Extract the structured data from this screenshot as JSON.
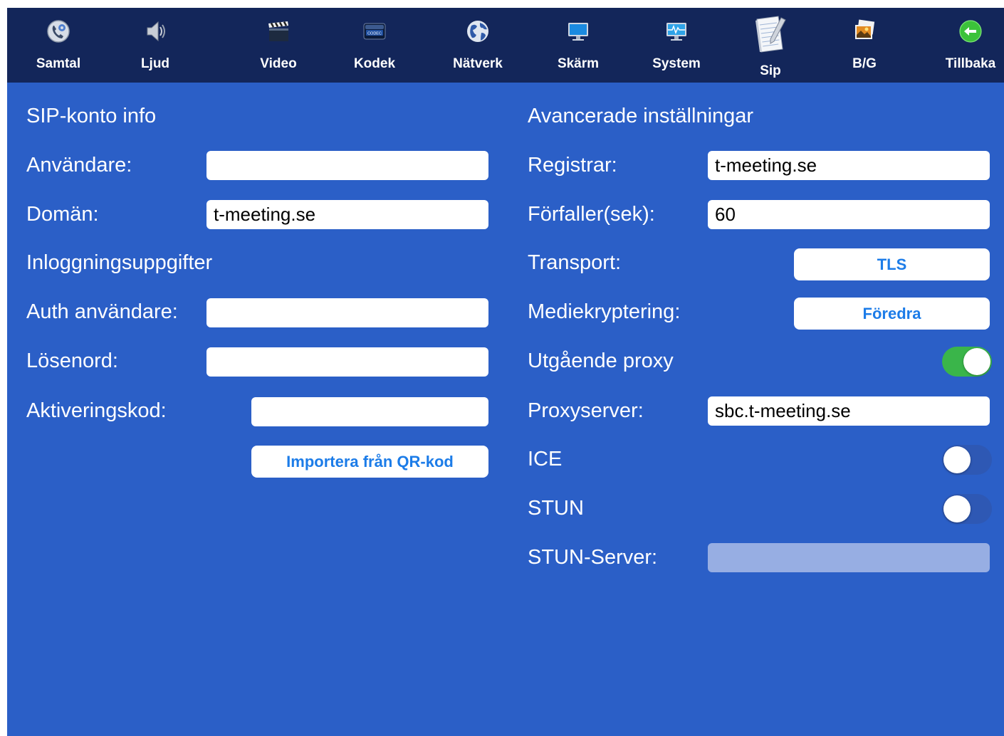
{
  "toolbar": {
    "items": [
      {
        "label": "Samtal",
        "icon": "phone-gear-icon"
      },
      {
        "label": "Ljud",
        "icon": "speaker-icon"
      },
      {
        "label": "Video",
        "icon": "clapperboard-icon"
      },
      {
        "label": "Kodek",
        "icon": "codec-chip-icon"
      },
      {
        "label": "Nätverk",
        "icon": "globe-icon"
      },
      {
        "label": "Skärm",
        "icon": "monitor-icon"
      },
      {
        "label": "System",
        "icon": "system-monitor-icon"
      },
      {
        "label": "Sip",
        "icon": "notepad-pen-icon",
        "active": true
      },
      {
        "label": "B/G",
        "icon": "pictures-icon"
      },
      {
        "label": "Tillbaka",
        "icon": "back-arrow-icon"
      }
    ],
    "codec_icon_text": "CODEC"
  },
  "left": {
    "title": "SIP-konto info",
    "user_label": "Användare:",
    "user_value": "",
    "domain_label": "Domän:",
    "domain_value": "t-meeting.se",
    "login_title": "Inloggningsuppgifter",
    "auth_user_label": "Auth användare:",
    "auth_user_value": "",
    "password_label": "Lösenord:",
    "password_value": "",
    "activation_label": "Aktiveringskod:",
    "activation_value": "",
    "qr_button": "Importera från QR-kod"
  },
  "right": {
    "title": "Avancerade inställningar",
    "registrar_label": "Registrar:",
    "registrar_value": "t-meeting.se",
    "expires_label": "Förfaller(sek):",
    "expires_value": "60",
    "transport_label": "Transport:",
    "transport_value": "TLS",
    "media_encryption_label": "Mediekryptering:",
    "media_encryption_value": "Föredra",
    "outbound_proxy_label": "Utgående proxy",
    "outbound_proxy_on": true,
    "proxy_server_label": "Proxyserver:",
    "proxy_server_value": "sbc.t-meeting.se",
    "ice_label": "ICE",
    "ice_on": false,
    "stun_label": "STUN",
    "stun_on": false,
    "stun_server_label": "STUN-Server:",
    "stun_server_value": ""
  },
  "colors": {
    "background": "#2b5fc7",
    "toolbar": "#13265a",
    "button_text": "#1c7ce8",
    "toggle_on": "#3ab54a",
    "disabled_field": "#97aee3"
  }
}
